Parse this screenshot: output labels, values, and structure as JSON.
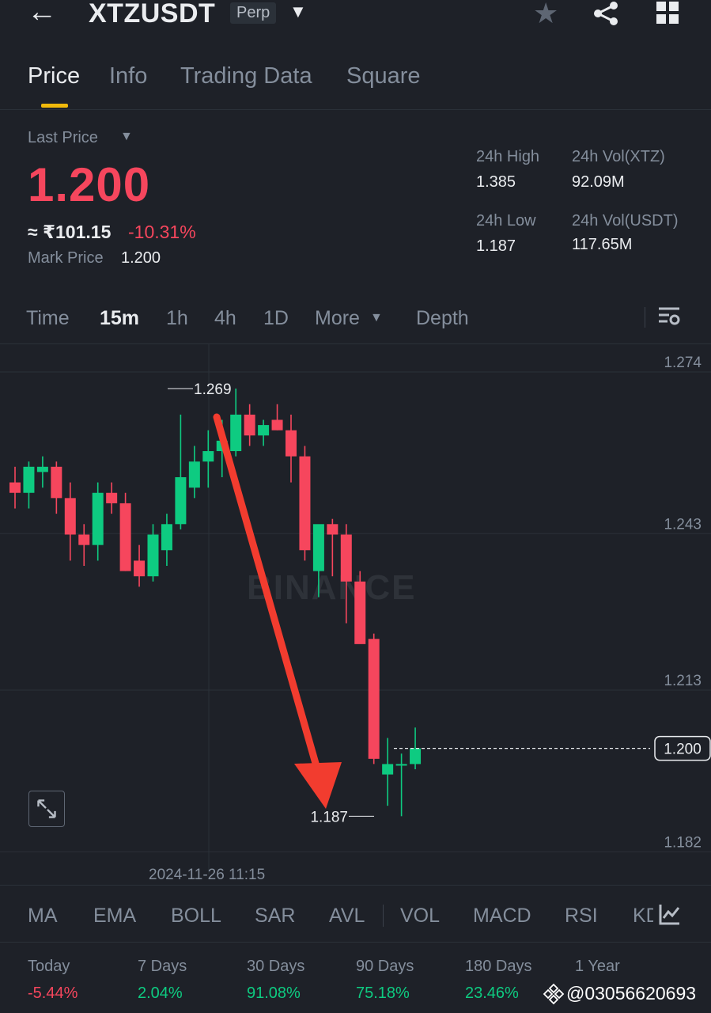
{
  "header": {
    "symbol": "XTZUSDT",
    "badge": "Perp",
    "back": "←",
    "dropdown": "▼",
    "star": "★"
  },
  "tabs": [
    {
      "label": "Price",
      "active": true
    },
    {
      "label": "Info"
    },
    {
      "label": "Trading Data"
    },
    {
      "label": "Square"
    }
  ],
  "price": {
    "last_price_label": "Last Price",
    "last_price": "1.200",
    "inr": "≈ ₹101.15",
    "change": "-10.31%",
    "mark_label": "Mark Price",
    "mark_value": "1.200"
  },
  "stats": {
    "high_label": "24h High",
    "high": "1.385",
    "low_label": "24h Low",
    "low": "1.187",
    "vol_xtz_label": "24h Vol(XTZ)",
    "vol_xtz": "92.09M",
    "vol_usdt_label": "24h Vol(USDT)",
    "vol_usdt": "117.65M"
  },
  "timeframes": [
    "Time",
    "15m",
    "1h",
    "4h",
    "1D",
    "More",
    "Depth"
  ],
  "active_timeframe": "15m",
  "chart": {
    "y_labels": [
      "1.274",
      "1.243",
      "1.213",
      "1.182"
    ],
    "current_price_tag": "1.200",
    "high_marker": "1.269",
    "low_marker": "1.187",
    "date_label": "2024-11-26 11:15",
    "watermark": "BINANCE",
    "colors": {
      "up": "#0ecb81",
      "down": "#f6465d",
      "arrow": "#f23c2f"
    },
    "candles": [
      {
        "o": 1.251,
        "h": 1.254,
        "l": 1.246,
        "c": 1.249
      },
      {
        "o": 1.249,
        "h": 1.255,
        "l": 1.246,
        "c": 1.254
      },
      {
        "o": 1.253,
        "h": 1.256,
        "l": 1.25,
        "c": 1.254
      },
      {
        "o": 1.254,
        "h": 1.255,
        "l": 1.245,
        "c": 1.248
      },
      {
        "o": 1.248,
        "h": 1.251,
        "l": 1.236,
        "c": 1.241
      },
      {
        "o": 1.241,
        "h": 1.243,
        "l": 1.235,
        "c": 1.239
      },
      {
        "o": 1.239,
        "h": 1.251,
        "l": 1.236,
        "c": 1.249
      },
      {
        "o": 1.249,
        "h": 1.251,
        "l": 1.245,
        "c": 1.247
      },
      {
        "o": 1.247,
        "h": 1.249,
        "l": 1.234,
        "c": 1.234
      },
      {
        "o": 1.236,
        "h": 1.239,
        "l": 1.231,
        "c": 1.233
      },
      {
        "o": 1.233,
        "h": 1.243,
        "l": 1.232,
        "c": 1.241
      },
      {
        "o": 1.238,
        "h": 1.245,
        "l": 1.235,
        "c": 1.243
      },
      {
        "o": 1.243,
        "h": 1.264,
        "l": 1.242,
        "c": 1.252
      },
      {
        "o": 1.25,
        "h": 1.258,
        "l": 1.248,
        "c": 1.255
      },
      {
        "o": 1.255,
        "h": 1.261,
        "l": 1.25,
        "c": 1.257
      },
      {
        "o": 1.257,
        "h": 1.263,
        "l": 1.252,
        "c": 1.259
      },
      {
        "o": 1.257,
        "h": 1.269,
        "l": 1.256,
        "c": 1.264
      },
      {
        "o": 1.264,
        "h": 1.266,
        "l": 1.258,
        "c": 1.26
      },
      {
        "o": 1.26,
        "h": 1.263,
        "l": 1.258,
        "c": 1.262
      },
      {
        "o": 1.263,
        "h": 1.266,
        "l": 1.261,
        "c": 1.261
      },
      {
        "o": 1.261,
        "h": 1.264,
        "l": 1.251,
        "c": 1.256
      },
      {
        "o": 1.256,
        "h": 1.258,
        "l": 1.236,
        "c": 1.238
      },
      {
        "o": 1.234,
        "h": 1.242,
        "l": 1.229,
        "c": 1.243
      },
      {
        "o": 1.243,
        "h": 1.244,
        "l": 1.233,
        "c": 1.241
      },
      {
        "o": 1.241,
        "h": 1.243,
        "l": 1.224,
        "c": 1.232
      },
      {
        "o": 1.232,
        "h": 1.234,
        "l": 1.221,
        "c": 1.22
      },
      {
        "o": 1.221,
        "h": 1.222,
        "l": 1.197,
        "c": 1.198
      },
      {
        "o": 1.195,
        "h": 1.202,
        "l": 1.189,
        "c": 1.197
      },
      {
        "o": 1.197,
        "h": 1.199,
        "l": 1.187,
        "c": 1.197
      },
      {
        "o": 1.197,
        "h": 1.204,
        "l": 1.196,
        "c": 1.2
      }
    ]
  },
  "indicators": [
    "MA",
    "EMA",
    "BOLL",
    "SAR",
    "AVL",
    "VOL",
    "MACD",
    "RSI",
    "KDJ"
  ],
  "performance": [
    {
      "label": "Today",
      "value": "-5.44%",
      "trend": "neg"
    },
    {
      "label": "7 Days",
      "value": "2.04%",
      "trend": "pos"
    },
    {
      "label": "30 Days",
      "value": "91.08%",
      "trend": "pos"
    },
    {
      "label": "90 Days",
      "value": "75.18%",
      "trend": "pos"
    },
    {
      "label": "180 Days",
      "value": "23.46%",
      "trend": "pos"
    },
    {
      "label": "1 Year",
      "value": "",
      "trend": "pos"
    }
  ],
  "overlay_handle": "@03056620693"
}
